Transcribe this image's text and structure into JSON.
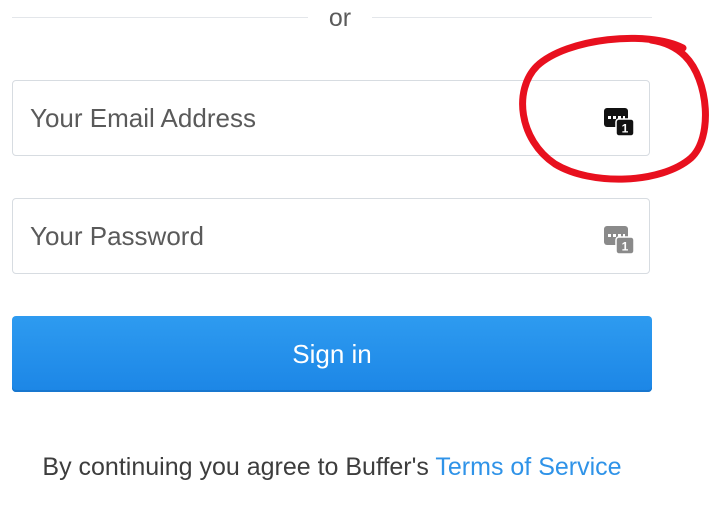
{
  "divider": {
    "label": "or"
  },
  "email": {
    "placeholder": "Your Email Address",
    "value": ""
  },
  "password": {
    "placeholder": "Your Password",
    "value": ""
  },
  "password_manager_icon": {
    "name": "password-manager-icon",
    "badge": "1"
  },
  "signin": {
    "label": "Sign in"
  },
  "terms": {
    "prefix": "By continuing you agree to Buffer's ",
    "link": "Terms of Service"
  },
  "colors": {
    "accent": "#2a93ec",
    "link": "#2f93e8",
    "annotation": "#e8101e"
  }
}
